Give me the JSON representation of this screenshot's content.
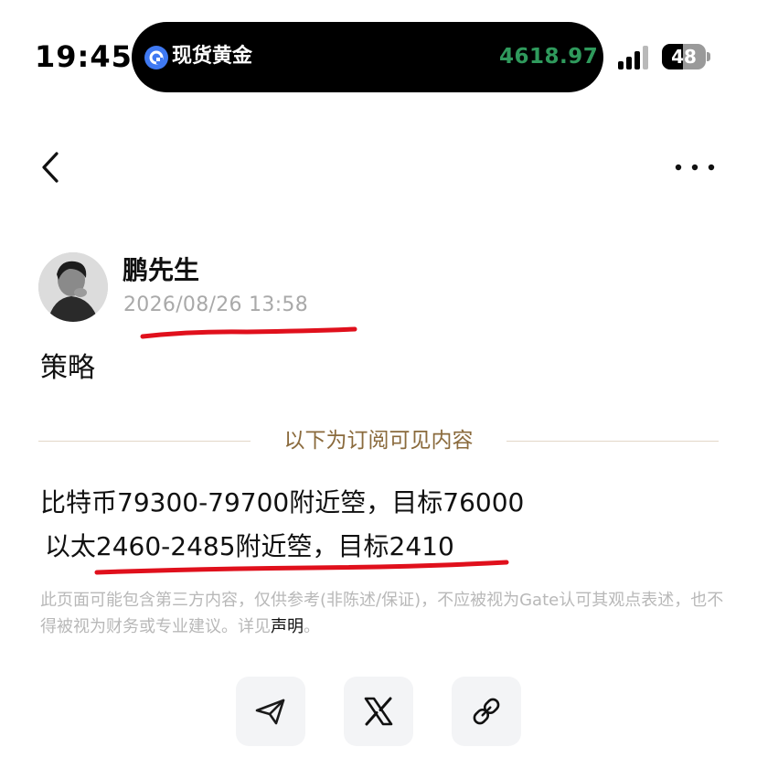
{
  "status_bar": {
    "time": "19:45",
    "island": {
      "title": "现货黄金",
      "price": "4618.97",
      "logo_icon": "q-brand-logo-icon"
    },
    "signal_bars": 4,
    "battery_percent": "48",
    "battery_level": 0.48
  },
  "nav": {
    "back_icon": "chevron-left-icon",
    "more_icon": "more-horizontal-icon"
  },
  "post": {
    "author": "鹏先生",
    "timestamp": "2026/08/26 13:58",
    "title": "策略",
    "divider_label": "以下为订阅可见内容",
    "content_lines": [
      "比特币79300-79700附近箜，目标76000",
      " 以太2460-2485附近箜，目标2410"
    ]
  },
  "disclaimer": {
    "text": "此页面可能包含第三方内容，仅供参考(非陈述/保证)，不应被视为Gate认可其观点表述，也不得被视为财务或专业建议。详见",
    "link_label": "声明",
    "suffix": "。"
  },
  "share": {
    "buttons": [
      {
        "name": "telegram",
        "icon": "telegram-send-icon"
      },
      {
        "name": "x",
        "icon": "x-logo-icon"
      },
      {
        "name": "copy-link",
        "icon": "link-icon"
      }
    ]
  },
  "colors": {
    "price_green": "#2f9a5c",
    "divider_gold": "#8a6a3c",
    "annotation_red": "#e0101c",
    "muted_gray": "#a9a9a9"
  }
}
